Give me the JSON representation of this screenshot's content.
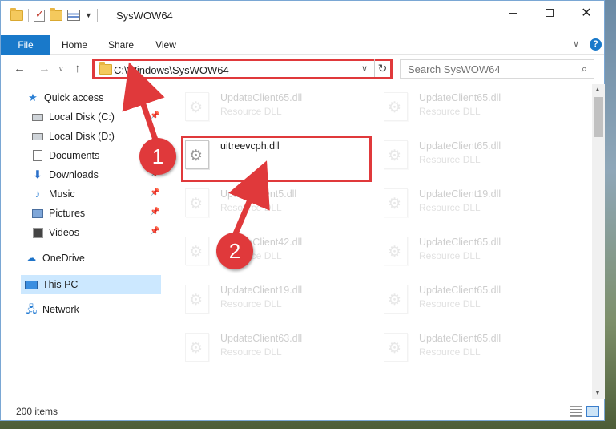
{
  "window": {
    "title": "SysWOW64"
  },
  "ribbon": {
    "tabs": [
      "File",
      "Home",
      "Share",
      "View"
    ],
    "help_label": "?"
  },
  "address": {
    "path": "C:\\Windows\\SysWOW64",
    "search_placeholder": "Search SysWOW64"
  },
  "navpane": {
    "items": [
      {
        "label": "Quick access",
        "icon": "star-icon",
        "pinned": false
      },
      {
        "label": "Local Disk (C:)",
        "icon": "disk-icon",
        "pinned": true
      },
      {
        "label": "Local Disk (D:)",
        "icon": "disk-icon",
        "pinned": false
      },
      {
        "label": "Documents",
        "icon": "documents-icon",
        "pinned": true
      },
      {
        "label": "Downloads",
        "icon": "download-icon",
        "pinned": true
      },
      {
        "label": "Music",
        "icon": "music-icon",
        "pinned": true
      },
      {
        "label": "Pictures",
        "icon": "pictures-icon",
        "pinned": true
      },
      {
        "label": "Videos",
        "icon": "videos-icon",
        "pinned": true
      },
      {
        "label": "OneDrive",
        "icon": "onedrive-icon",
        "pinned": false
      },
      {
        "label": "This PC",
        "icon": "pc-icon",
        "pinned": false,
        "selected": true
      },
      {
        "label": "Network",
        "icon": "network-icon",
        "pinned": false
      }
    ]
  },
  "files": {
    "left_column": [
      {
        "name": "UpdateClient65.dll",
        "type": "Resource DLL"
      },
      {
        "name": "uitreevcph.dll",
        "type": ""
      },
      {
        "name": "UpdateClient5.dll",
        "type": "Resource DLL"
      },
      {
        "name": "UpdateClient42.dll",
        "type": "Resource DLL"
      },
      {
        "name": "UpdateClient19.dll",
        "type": "Resource DLL"
      },
      {
        "name": "UpdateClient63.dll",
        "type": "Resource DLL"
      }
    ],
    "right_column": [
      {
        "name": "UpdateClient65.dll",
        "type": "Resource DLL"
      },
      {
        "name": "UpdateClient65.dll",
        "type": "Resource DLL"
      },
      {
        "name": "UpdateClient19.dll",
        "type": "Resource DLL"
      },
      {
        "name": "UpdateClient65.dll",
        "type": "Resource DLL"
      },
      {
        "name": "UpdateClient65.dll",
        "type": "Resource DLL"
      },
      {
        "name": "UpdateClient65.dll",
        "type": "Resource DLL"
      }
    ]
  },
  "status": {
    "item_count": "200 items"
  },
  "annotations": {
    "step1": "1",
    "step2": "2",
    "color": "#e0393b"
  }
}
